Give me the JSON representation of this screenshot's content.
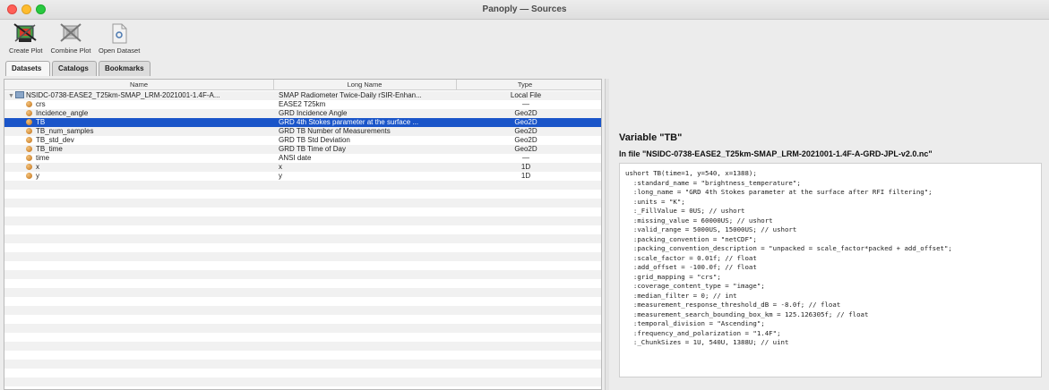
{
  "window": {
    "title": "Panoply — Sources"
  },
  "toolbar": {
    "create_plot": "Create Plot",
    "combine_plot": "Combine Plot",
    "open_dataset": "Open Dataset"
  },
  "tabs": [
    "Datasets",
    "Catalogs",
    "Bookmarks"
  ],
  "table": {
    "headers": {
      "name": "Name",
      "long_name": "Long Name",
      "type": "Type"
    },
    "root": {
      "name": "NSIDC-0738-EASE2_T25km-SMAP_LRM-2021001-1.4F-A...",
      "long_name": "SMAP Radiometer Twice-Daily rSIR-Enhan...",
      "type": "Local File"
    },
    "rows": [
      {
        "name": "crs",
        "long_name": "EASE2 T25km",
        "type": "—"
      },
      {
        "name": "Incidence_angle",
        "long_name": "GRD Incidence Angle",
        "type": "Geo2D"
      },
      {
        "name": "TB",
        "long_name": "GRD 4th Stokes parameter at the surface ...",
        "type": "Geo2D"
      },
      {
        "name": "TB_num_samples",
        "long_name": "GRD TB Number of Measurements",
        "type": "Geo2D"
      },
      {
        "name": "TB_std_dev",
        "long_name": "GRD TB Std Deviation",
        "type": "Geo2D"
      },
      {
        "name": "TB_time",
        "long_name": "GRD TB Time of Day",
        "type": "Geo2D"
      },
      {
        "name": "time",
        "long_name": "ANSI date",
        "type": "—"
      },
      {
        "name": "x",
        "long_name": "x",
        "type": "1D"
      },
      {
        "name": "y",
        "long_name": "y",
        "type": "1D"
      }
    ]
  },
  "variable": {
    "title": "Variable \"TB\"",
    "file_line": "In file \"NSIDC-0738-EASE2_T25km-SMAP_LRM-2021001-1.4F-A-GRD-JPL-v2.0.nc\"",
    "attributes": [
      "ushort TB(time=1, y=540, x=1388);",
      "  :standard_name = \"brightness_temperature\";",
      "  :long_name = \"GRD 4th Stokes parameter at the surface after RFI filtering\";",
      "  :units = \"K\";",
      "  :_FillValue = 0US; // ushort",
      "  :missing_value = 60000US; // ushort",
      "  :valid_range = 5000US, 15000US; // ushort",
      "  :packing_convention = \"netCDF\";",
      "  :packing_convention_description = \"unpacked = scale_factor*packed + add_offset\";",
      "  :scale_factor = 0.01f; // float",
      "  :add_offset = -100.0f; // float",
      "  :grid_mapping = \"crs\";",
      "  :coverage_content_type = \"image\";",
      "  :median_filter = 0; // int",
      "  :measurement_response_threshold_dB = -8.0f; // float",
      "  :measurement_search_bounding_box_km = 125.126305f; // float",
      "  :temporal_division = \"Ascending\";",
      "  :frequency_and_polarization = \"1.4F\";",
      "  :_ChunkSizes = 1U, 540U, 1388U; // uint"
    ]
  }
}
